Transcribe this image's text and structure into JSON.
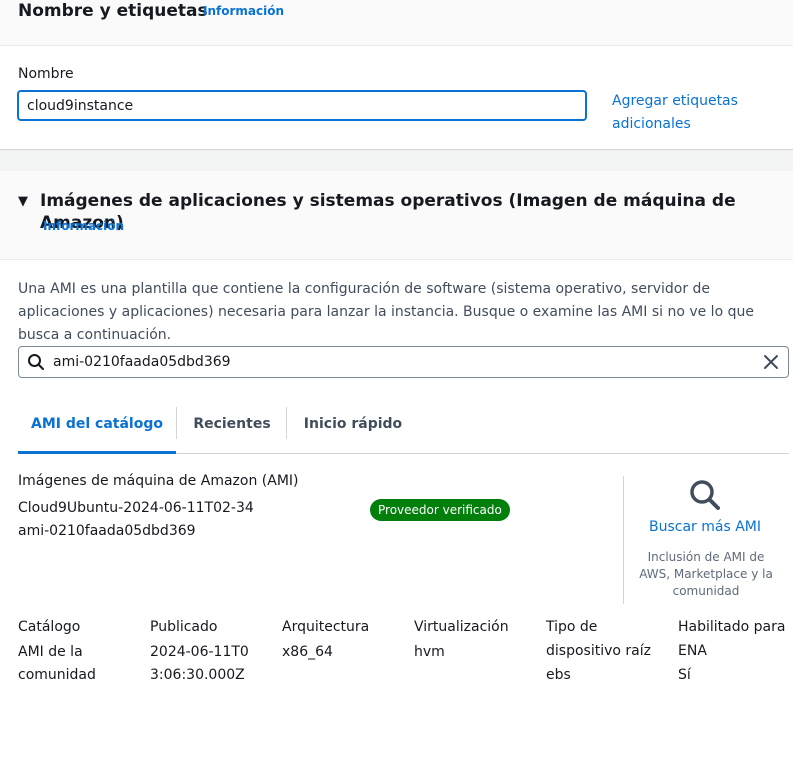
{
  "name_section": {
    "title": "Nombre y etiquetas",
    "info_link": "Información",
    "name_label": "Nombre",
    "name_value": "cloud9instance",
    "add_tags_link": "Agregar etiquetas adicionales"
  },
  "ami_section": {
    "caret": "▼",
    "title": "Imágenes de aplicaciones y sistemas operativos (Imagen de máquina de Amazon)",
    "info_link": "Información",
    "description": "Una AMI es una plantilla que contiene la configuración de software (sistema operativo, servidor de aplicaciones y aplicaciones) necesaria para lanzar la instancia. Busque o examine las AMI si no ve lo que busca a continuación.",
    "search_value": "ami-0210faada05dbd369",
    "tabs": [
      {
        "label": "AMI del catálogo",
        "selected": true
      },
      {
        "label": "Recientes",
        "selected": false
      },
      {
        "label": "Inicio rápido",
        "selected": false
      }
    ],
    "result_heading": "Imágenes de máquina de Amazon (AMI)",
    "ami_name": "Cloud9Ubuntu-2024-06-11T02-34",
    "ami_id": "ami-0210faada05dbd369",
    "verified_badge": "Proveedor verificado",
    "search_more_link": "Buscar más AMI",
    "search_more_desc": "Inclusión de AMI de AWS, Marketplace y la comunidad",
    "attributes": [
      {
        "label": "Catálogo",
        "value": "AMI de la comunidad"
      },
      {
        "label": "Publicado",
        "value": "2024-06-11T03:06:30.000Z"
      },
      {
        "label": "Arquitectura",
        "value": "x86_64"
      },
      {
        "label": "Virtualización",
        "value": "hvm"
      },
      {
        "label": "Tipo de dispositivo raíz",
        "value": "ebs"
      },
      {
        "label": "Habilitado para ENA",
        "value": "Sí"
      }
    ]
  },
  "colors": {
    "link": "#0972d3",
    "badge": "#037f0c",
    "text": "#16191f"
  }
}
